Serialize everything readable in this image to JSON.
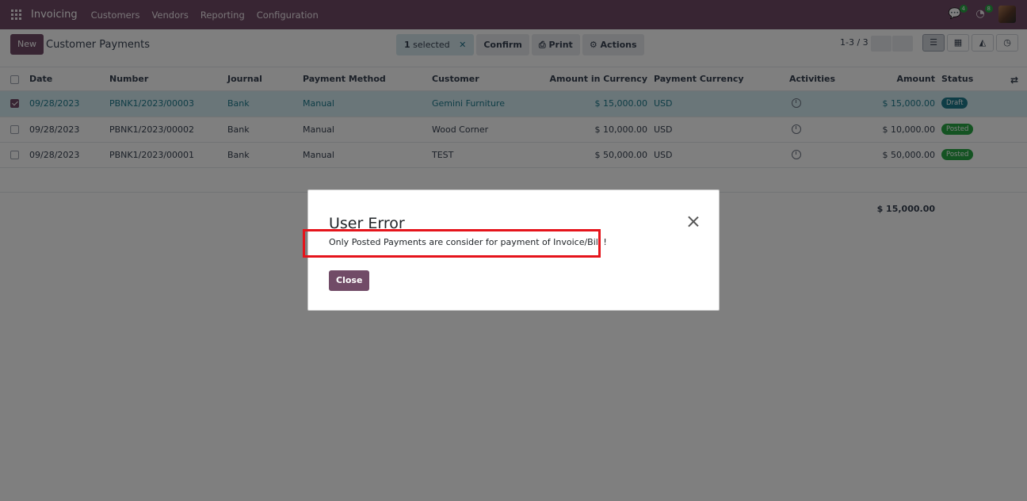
{
  "navbar": {
    "brand": "Invoicing",
    "menu": [
      "Customers",
      "Vendors",
      "Reporting",
      "Configuration"
    ],
    "messages_count": "4",
    "activities_count": "8",
    "color": "#714b67"
  },
  "control": {
    "new_label": "New",
    "title": "Customer Payments",
    "selected_count": "1",
    "selected_text": "selected",
    "confirm_label": "Confirm",
    "print_label": "Print",
    "actions_label": "Actions",
    "pager": "1-3 / 3"
  },
  "table": {
    "columns": {
      "date": "Date",
      "number": "Number",
      "journal": "Journal",
      "method": "Payment Method",
      "customer": "Customer",
      "amount_currency": "Amount in Currency",
      "currency": "Payment Currency",
      "activities": "Activities",
      "amount": "Amount",
      "status": "Status"
    },
    "rows": [
      {
        "date": "09/28/2023",
        "number": "PBNK1/2023/00003",
        "journal": "Bank",
        "method": "Manual",
        "customer": "Gemini Furniture",
        "amount_currency": "$ 15,000.00",
        "currency": "USD",
        "amount": "$ 15,000.00",
        "status": "Draft"
      },
      {
        "date": "09/28/2023",
        "number": "PBNK1/2023/00002",
        "journal": "Bank",
        "method": "Manual",
        "customer": "Wood Corner",
        "amount_currency": "$ 10,000.00",
        "currency": "USD",
        "amount": "$ 10,000.00",
        "status": "Posted"
      },
      {
        "date": "09/28/2023",
        "number": "PBNK1/2023/00001",
        "journal": "Bank",
        "method": "Manual",
        "customer": "TEST",
        "amount_currency": "$ 50,000.00",
        "currency": "USD",
        "amount": "$ 50,000.00",
        "status": "Posted"
      }
    ],
    "total": "$ 15,000.00"
  },
  "dialog": {
    "title": "User Error",
    "message": "Only Posted Payments are consider for payment of Invoice/Bill !",
    "close_label": "Close"
  }
}
